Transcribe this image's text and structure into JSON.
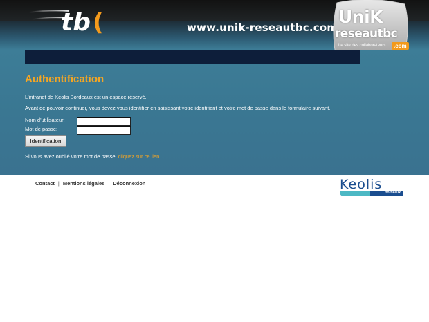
{
  "header": {
    "url_text": "www.unik-reseautbc.com",
    "badge_title": "UniK",
    "badge_subtitle": "reseautbc",
    "badge_tagline": "Le site des collaborateurs",
    "badge_com": ".com"
  },
  "main": {
    "title": "Authentification",
    "intro": "L'intranet de Keolis Bordeaux est un espace réservé.",
    "instructions": "Avant de pouvoir continuer, vous devez vous identifier en saisissant votre identifiant et votre mot de passe dans le formulaire suivant.",
    "username_label": "Nom d'utilisateur:",
    "password_label": "Mot de passe:",
    "username_value": "",
    "password_value": "",
    "submit_label": "Identification",
    "forgot_text": "Si vous avez oublié votre mot de passe,",
    "forgot_link": "cliquez sur ce lien."
  },
  "footer": {
    "links": [
      "Contact",
      "Mentions légales",
      "Déconnexion"
    ],
    "separator": "|",
    "brand": "Keolis",
    "brand_sub": "Bordeaux"
  },
  "colors": {
    "accent": "#f5a623",
    "nav_bar": "#0d1e3a",
    "main_bg": "#3a7792",
    "brand_blue": "#1a4d8f"
  }
}
